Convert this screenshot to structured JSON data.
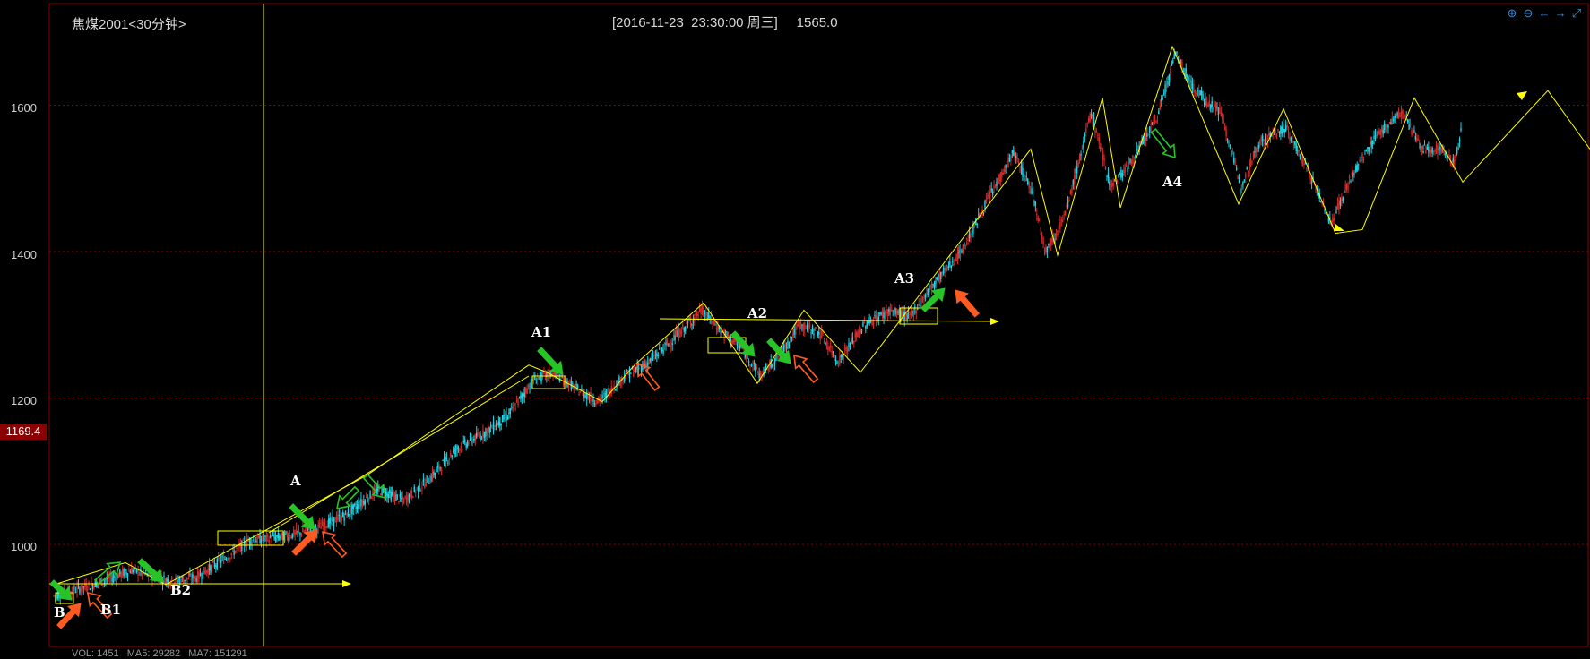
{
  "window": {
    "instrument": "焦煤2001<30分钟>",
    "cursor_info": "[2016-11-23  23:30:00 周三]     1565.0",
    "price_badge": "1169.4",
    "footer": "VOL: 1451   MA5: 29282   MA7: 151291"
  },
  "toolbar": [
    {
      "name": "zoom-in-icon",
      "glyph": "⊕"
    },
    {
      "name": "zoom-out-icon",
      "glyph": "⊖"
    },
    {
      "name": "scroll-left-icon",
      "glyph": "←"
    },
    {
      "name": "scroll-right-icon",
      "glyph": "→"
    },
    {
      "name": "expand-icon",
      "glyph": "⤢"
    }
  ],
  "colors": {
    "up_candle": "#d42a2a",
    "down_candle": "#1ed6e6",
    "trendline": "#ffff00",
    "grid": "#8b0000",
    "crosshair": "#ffff00",
    "buy_arrow": "#ff5a1f",
    "sell_arrow": "#27c427"
  },
  "chart_data": {
    "type": "candlestick",
    "title": "焦煤2001<30分钟>",
    "ylim": [
      900,
      1700
    ],
    "y_ticks": [
      1000,
      1200,
      1400,
      1600
    ],
    "grid": true,
    "annotations": [
      "B",
      "B1",
      "B2",
      "A",
      "A1",
      "A2",
      "A3",
      "A4"
    ],
    "price_path": [
      [
        0,
        930
      ],
      [
        30,
        945
      ],
      [
        60,
        965
      ],
      [
        90,
        950
      ],
      [
        110,
        955
      ],
      [
        135,
        985
      ],
      [
        150,
        1005
      ],
      [
        175,
        1010
      ],
      [
        200,
        1020
      ],
      [
        225,
        1040
      ],
      [
        250,
        1075
      ],
      [
        270,
        1060
      ],
      [
        290,
        1090
      ],
      [
        310,
        1130
      ],
      [
        330,
        1150
      ],
      [
        350,
        1175
      ],
      [
        370,
        1225
      ],
      [
        385,
        1235
      ],
      [
        405,
        1210
      ],
      [
        420,
        1195
      ],
      [
        440,
        1230
      ],
      [
        460,
        1250
      ],
      [
        480,
        1285
      ],
      [
        500,
        1320
      ],
      [
        515,
        1290
      ],
      [
        530,
        1270
      ],
      [
        545,
        1230
      ],
      [
        560,
        1260
      ],
      [
        575,
        1300
      ],
      [
        590,
        1290
      ],
      [
        605,
        1250
      ],
      [
        625,
        1300
      ],
      [
        645,
        1320
      ],
      [
        660,
        1310
      ],
      [
        680,
        1360
      ],
      [
        700,
        1400
      ],
      [
        720,
        1470
      ],
      [
        740,
        1535
      ],
      [
        755,
        1480
      ],
      [
        765,
        1400
      ],
      [
        780,
        1450
      ],
      [
        800,
        1590
      ],
      [
        815,
        1490
      ],
      [
        830,
        1520
      ],
      [
        850,
        1580
      ],
      [
        865,
        1670
      ],
      [
        880,
        1620
      ],
      [
        900,
        1590
      ],
      [
        915,
        1490
      ],
      [
        930,
        1550
      ],
      [
        950,
        1570
      ],
      [
        970,
        1500
      ],
      [
        985,
        1440
      ],
      [
        1000,
        1500
      ],
      [
        1020,
        1560
      ],
      [
        1040,
        1590
      ],
      [
        1055,
        1540
      ],
      [
        1070,
        1540
      ],
      [
        1080,
        1520
      ],
      [
        1085,
        1565
      ]
    ]
  }
}
